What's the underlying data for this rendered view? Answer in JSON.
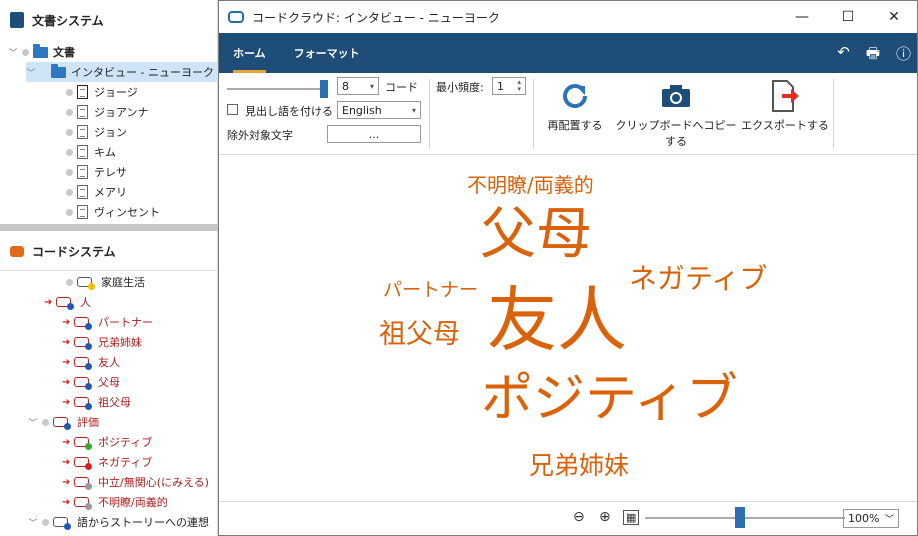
{
  "left": {
    "docs_header": "文書システム",
    "codes_header": "コードシステム",
    "docs_root": "文書",
    "docs_group": "インタビュー - ニューヨーク",
    "documents": [
      "ジョージ",
      "ジョアンナ",
      "ジョン",
      "キム",
      "テレサ",
      "メアリ",
      "ヴィンセント"
    ],
    "codes": [
      {
        "label": "家庭生活",
        "indent": 2,
        "red": false,
        "dot": "#f2c200",
        "arrow": false
      },
      {
        "label": "人",
        "indent": 1,
        "red": true,
        "dot": "#2257b8",
        "arrow": true
      },
      {
        "label": "パートナー",
        "indent": 2,
        "red": true,
        "dot": "#2257b8",
        "arrow": true
      },
      {
        "label": "兄弟姉妹",
        "indent": 2,
        "red": true,
        "dot": "#2257b8",
        "arrow": true
      },
      {
        "label": "友人",
        "indent": 2,
        "red": true,
        "dot": "#2257b8",
        "arrow": true
      },
      {
        "label": "父母",
        "indent": 2,
        "red": true,
        "dot": "#2257b8",
        "arrow": true
      },
      {
        "label": "祖父母",
        "indent": 2,
        "red": true,
        "dot": "#2257b8",
        "arrow": true
      },
      {
        "label": "評価",
        "indent": 1,
        "red": true,
        "dot": "#2257b8",
        "arrow": false
      },
      {
        "label": "ポジティブ",
        "indent": 2,
        "red": true,
        "dot": "#3aa635",
        "arrow": true
      },
      {
        "label": "ネガティブ",
        "indent": 2,
        "red": true,
        "dot": "#d42020",
        "arrow": true
      },
      {
        "label": "中立/無関心(にみえる)",
        "indent": 2,
        "red": true,
        "dot": "#999999",
        "arrow": true
      },
      {
        "label": "不明瞭/両義的",
        "indent": 2,
        "red": true,
        "dot": "#999999",
        "arrow": true
      },
      {
        "label": "語からストーリーへの連想",
        "indent": 1,
        "red": false,
        "dot": "#2257b8",
        "arrow": false
      }
    ]
  },
  "window": {
    "title": "コードクラウド: インタビュー - ニューヨーク",
    "tabs": [
      "ホーム",
      "フォーマット"
    ]
  },
  "ribbon": {
    "code_count": "8",
    "code_label": "コード",
    "headword_label": "見出し語を付ける",
    "language": "English",
    "exclude_label": "除外対象文字",
    "exclude_button": "...",
    "min_freq_label": "最小頻度:",
    "min_freq": "1",
    "rearrange": "再配置する",
    "copy_clipboard": "クリップボードへコピーする",
    "export": "エクスポートする"
  },
  "cloud": {
    "color": "#d9620b",
    "words": [
      {
        "text": "不明瞭/両義的",
        "size": 20
      },
      {
        "text": "父母",
        "size": 56
      },
      {
        "text": "パートナー",
        "size": 19
      },
      {
        "text": "ネガティブ",
        "size": 28
      },
      {
        "text": "祖父母",
        "size": 27
      },
      {
        "text": "友人",
        "size": 70
      },
      {
        "text": "ポジティブ",
        "size": 52
      },
      {
        "text": "兄弟姉妹",
        "size": 25
      }
    ]
  },
  "status": {
    "zoom": "100%"
  }
}
